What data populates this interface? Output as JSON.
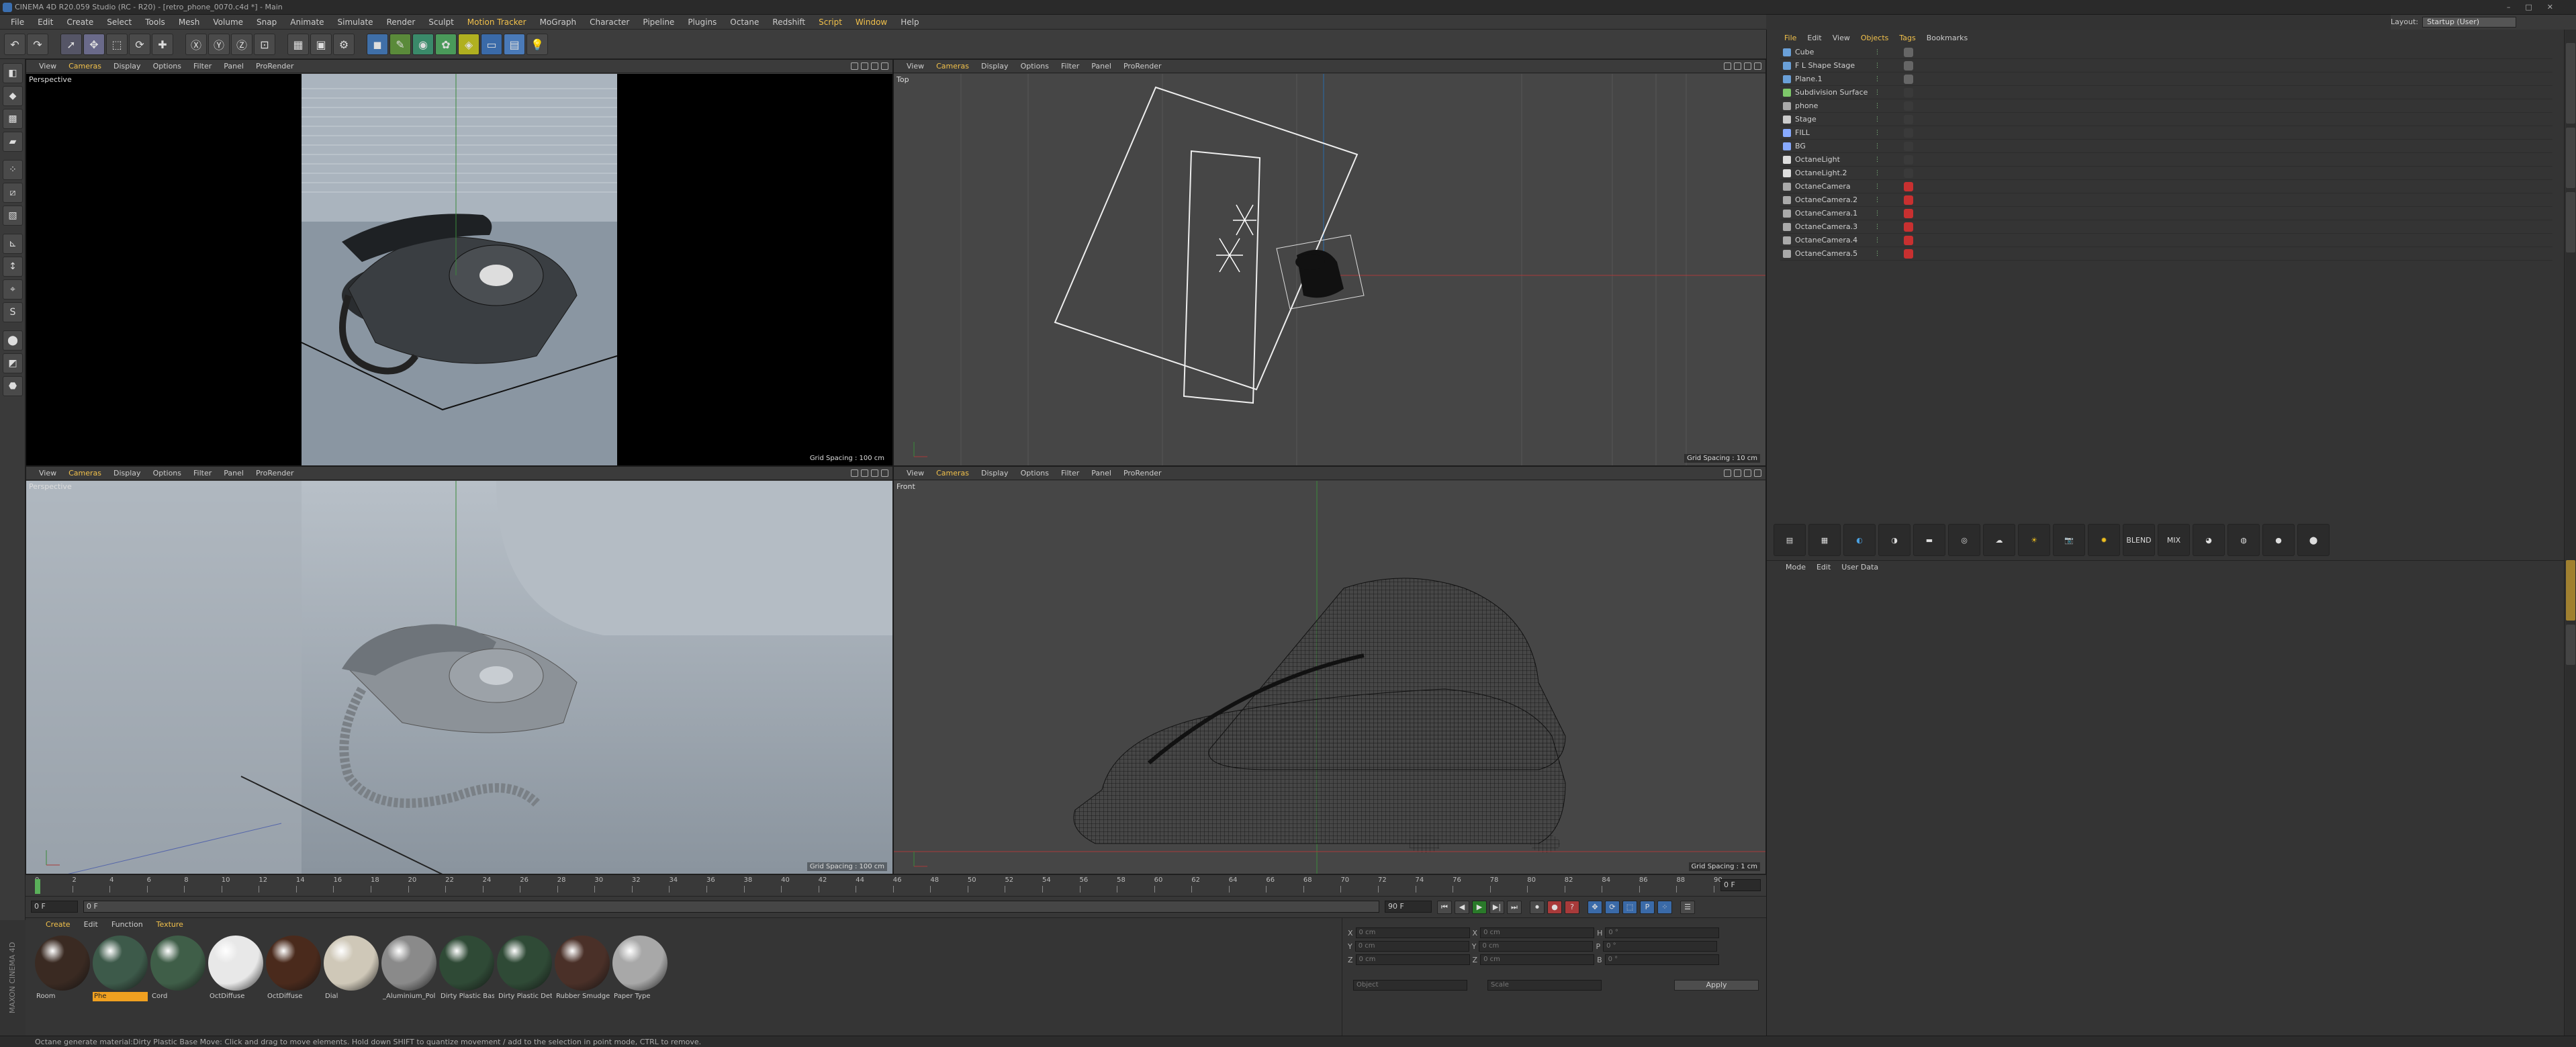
{
  "window": {
    "title": "CINEMA 4D R20.059 Studio (RC - R20) - [retro_phone_0070.c4d *] - Main"
  },
  "menu": [
    "File",
    "Edit",
    "Create",
    "Select",
    "Tools",
    "Mesh",
    "Volume",
    "Snap",
    "Animate",
    "Simulate",
    "Render",
    "Sculpt",
    "Motion Tracker",
    "MoGraph",
    "Character",
    "Pipeline",
    "Plugins",
    "Octane",
    "Redshift",
    "Script",
    "Window",
    "Help"
  ],
  "layout": {
    "label": "Layout:",
    "value": "Startup (User)"
  },
  "viewport_menu": [
    "View",
    "Cameras",
    "Display",
    "Options",
    "Filter",
    "Panel",
    "ProRender"
  ],
  "viewports": {
    "tl": {
      "label": "Perspective",
      "grid": "Grid Spacing : 100 cm"
    },
    "tr": {
      "label": "Top",
      "grid": "Grid Spacing : 10 cm"
    },
    "bl": {
      "label": "Perspective",
      "grid": "Grid Spacing : 100 cm"
    },
    "br": {
      "label": "Front",
      "grid": "Grid Spacing : 1 cm"
    }
  },
  "timeline": {
    "ticks": [
      "0",
      "2",
      "4",
      "6",
      "8",
      "10",
      "12",
      "14",
      "16",
      "18",
      "20",
      "22",
      "24",
      "26",
      "28",
      "30",
      "32",
      "34",
      "36",
      "38",
      "40",
      "42",
      "44",
      "46",
      "48",
      "50",
      "52",
      "54",
      "56",
      "58",
      "60",
      "62",
      "64",
      "66",
      "68",
      "70",
      "72",
      "74",
      "76",
      "78",
      "80",
      "82",
      "84",
      "86",
      "88",
      "90"
    ],
    "current_frame": "0 F",
    "start": "0 F",
    "end": "90 F",
    "right_field": "0 F"
  },
  "materials": {
    "menu": [
      "Create",
      "Edit",
      "Function",
      "Texture"
    ],
    "items": [
      {
        "label": "Room",
        "color": "#3a2a22"
      },
      {
        "label": "Phe",
        "color": "#3d5a4a",
        "selected": true
      },
      {
        "label": "Cord",
        "color": "#3f5e48"
      },
      {
        "label": "OctDiffuse",
        "color": "#e8e8e8"
      },
      {
        "label": "OctDiffuse",
        "color": "#4a2a1c"
      },
      {
        "label": "Dial",
        "color": "#cfc8b8"
      },
      {
        "label": "_Aluminium_Pol",
        "color": "#8a8a8a"
      },
      {
        "label": "Dirty Plastic Base",
        "color": "#2f4a36"
      },
      {
        "label": "Dirty Plastic Detai",
        "color": "#2f4a36"
      },
      {
        "label": "Rubber Smudges",
        "color": "#4a3028"
      },
      {
        "label": "Paper Type",
        "color": "#a8a8a8"
      }
    ]
  },
  "coordinates": {
    "rows": [
      {
        "axis": "X",
        "pos": "0 cm",
        "rot_axis": "X",
        "rot": "0 cm",
        "s_axis": "H",
        "s": "0 °"
      },
      {
        "axis": "Y",
        "pos": "0 cm",
        "rot_axis": "Y",
        "rot": "0 cm",
        "s_axis": "P",
        "s": "0 °"
      },
      {
        "axis": "Z",
        "pos": "0 cm",
        "rot_axis": "Z",
        "rot": "0 cm",
        "s_axis": "B",
        "s": "0 °"
      }
    ],
    "mode1": "Object",
    "mode2": "Scale",
    "apply": "Apply"
  },
  "objects": {
    "menu": [
      "File",
      "Edit",
      "View",
      "Objects",
      "Tags",
      "Bookmarks"
    ],
    "items": [
      {
        "name": "Cube",
        "icon_color": "#6aa0d8"
      },
      {
        "name": "F L Shape Stage",
        "icon_color": "#6aa0d8"
      },
      {
        "name": "Plane.1",
        "icon_color": "#6aa0d8"
      },
      {
        "name": "Subdivision Surface",
        "icon_color": "#7ec86a"
      },
      {
        "name": "phone",
        "icon_color": "#aaaaaa"
      },
      {
        "name": "Stage",
        "icon_color": "#cccccc"
      },
      {
        "name": "FILL",
        "icon_color": "#88aaff"
      },
      {
        "name": "BG",
        "icon_color": "#88aaff"
      },
      {
        "name": "OctaneLight",
        "icon_color": "#dddddd"
      },
      {
        "name": "OctaneLight.2",
        "icon_color": "#dddddd"
      },
      {
        "name": "OctaneCamera",
        "icon_color": "#aaaaaa"
      },
      {
        "name": "OctaneCamera.2",
        "icon_color": "#aaaaaa"
      },
      {
        "name": "OctaneCamera.1",
        "icon_color": "#aaaaaa"
      },
      {
        "name": "OctaneCamera.3",
        "icon_color": "#aaaaaa"
      },
      {
        "name": "OctaneCamera.4",
        "icon_color": "#aaaaaa"
      },
      {
        "name": "OctaneCamera.5",
        "icon_color": "#aaaaaa"
      }
    ]
  },
  "octane_bar": [
    "BLEND",
    "MIX"
  ],
  "attributes": {
    "menu": [
      "Mode",
      "Edit",
      "User Data"
    ]
  },
  "status": "Octane generate material:Dirty Plastic Base    Move: Click and drag to move elements. Hold down SHIFT to quantize movement / add to the selection in point mode, CTRL to remove.",
  "brand": "MAXON CINEMA 4D"
}
